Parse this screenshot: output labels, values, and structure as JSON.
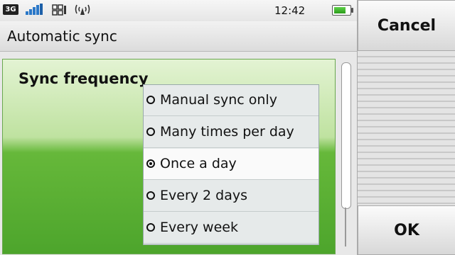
{
  "status_bar": {
    "network_label": "3G",
    "time": "12:42",
    "signal_icon": "signal-bars-icon",
    "grid_icon": "keypad-grid-icon",
    "wifi_icon": "wireless-icon",
    "battery_level": 0.75
  },
  "header": {
    "title": "Automatic sync"
  },
  "sync_frequency": {
    "label": "Sync frequency",
    "options": [
      {
        "label": "Manual sync only",
        "selected": false
      },
      {
        "label": "Many times per day",
        "selected": false
      },
      {
        "label": "Once a day",
        "selected": true
      },
      {
        "label": "Every 2 days",
        "selected": false
      },
      {
        "label": "Every week",
        "selected": false
      }
    ]
  },
  "softkeys": {
    "cancel_label": "Cancel",
    "ok_label": "OK"
  },
  "colors": {
    "panel_green": "#4da52c",
    "battery_green": "#2a9b1a"
  }
}
